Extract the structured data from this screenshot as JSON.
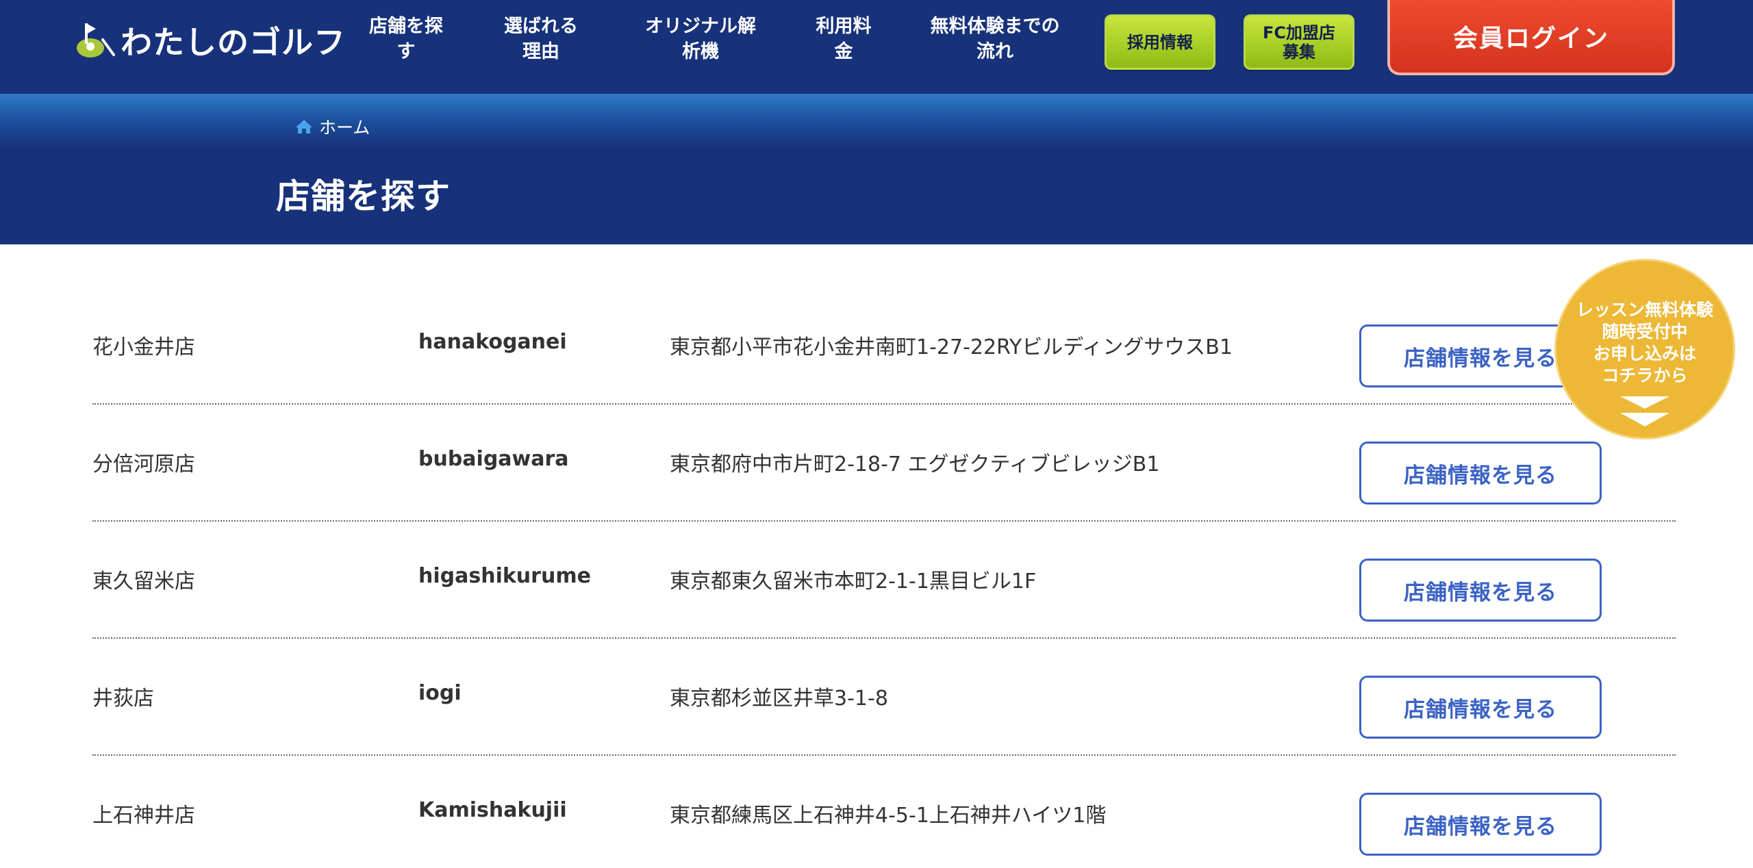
{
  "header": {
    "logo_text": "わたしのゴルフ",
    "nav": [
      {
        "label": "店舗を探\nす"
      },
      {
        "label": "選ばれる\n理由"
      },
      {
        "label": "オリジナル解\n析機"
      },
      {
        "label": "利用料\n金"
      },
      {
        "label": "無料体験までの\n流れ"
      }
    ],
    "recruit_label": "採用情報",
    "fc_label": "FC加盟店\n募集",
    "login_label": "会員ログイン",
    "colors": {
      "navy": "#17327a",
      "green": "#a8d02a",
      "red": "#e03c24"
    }
  },
  "hero": {
    "breadcrumb_home": "ホーム",
    "title": "店舗を探す"
  },
  "stores": [
    {
      "name": "花小金井店",
      "slug": "hanakoganei",
      "address": "東京都小平市花小金井南町1-27-22RYビルディングサウスB1",
      "button": "店舗情報を見る"
    },
    {
      "name": "分倍河原店",
      "slug": "bubaigawara",
      "address": "東京都府中市片町2-18-7 エグゼクティブビレッジB1",
      "button": "店舗情報を見る"
    },
    {
      "name": "東久留米店",
      "slug": "higashikurume",
      "address": "東京都東久留米市本町2-1-1黒目ビル1F",
      "button": "店舗情報を見る"
    },
    {
      "name": "井荻店",
      "slug": "iogi",
      "address": "東京都杉並区井草3-1-8",
      "button": "店舗情報を見る"
    },
    {
      "name": "上石神井店",
      "slug": "Kamishakujii",
      "address": "東京都練馬区上石神井4-5-1上石神井ハイツ1階",
      "button": "店舗情報を見る"
    }
  ],
  "badge": {
    "lines": [
      "レッスン無料体験",
      "随時受付中",
      "お申し込みは",
      "コチラから"
    ],
    "color": "#ecb836"
  }
}
